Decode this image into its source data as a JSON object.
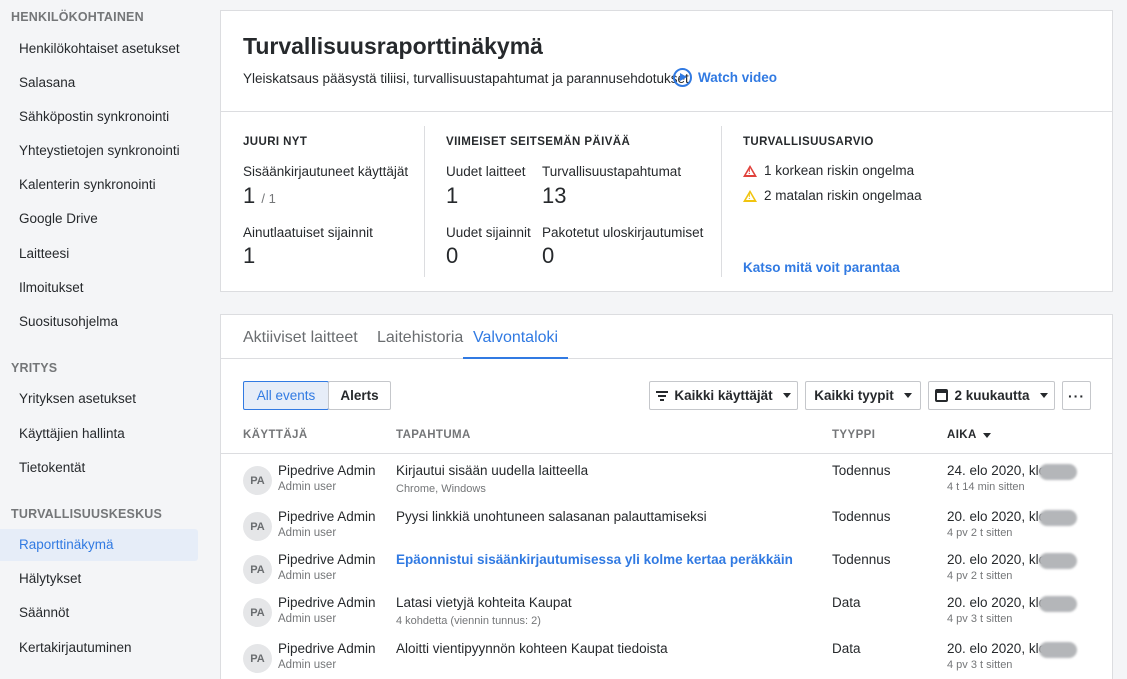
{
  "sidebar": {
    "sections": [
      {
        "title": "HENKILÖKOHTAINEN",
        "items": [
          "Henkilökohtaiset asetukset",
          "Salasana",
          "Sähköpostin synkronointi",
          "Yhteystietojen synkronointi",
          "Kalenterin synkronointi",
          "Google Drive",
          "Laitteesi",
          "Ilmoitukset",
          "Suositusohjelma"
        ]
      },
      {
        "title": "YRITYS",
        "items": [
          "Yrityksen asetukset",
          "Käyttäjien hallinta",
          "Tietokentät"
        ]
      },
      {
        "title": "TURVALLISUUSKESKUS",
        "items": [
          "Raporttinäkymä",
          "Hälytykset",
          "Säännöt",
          "Kertakirjautuminen"
        ]
      }
    ],
    "active_item": "Raporttinäkymä"
  },
  "header": {
    "title": "Turvallisuusraporttinäkymä",
    "subtitle": "Yleiskatsaus pääsystä tiliisi, turvallisuustapahtumat ja parannusehdotukset",
    "watch_video": "Watch video"
  },
  "stats": {
    "now": {
      "heading": "JUURI NYT",
      "logged_in_label": "Sisäänkirjautuneet käyttäjät",
      "logged_in_value": "1",
      "logged_in_total": "/ 1",
      "locations_label": "Ainutlaatuiset sijainnit",
      "locations_value": "1"
    },
    "week": {
      "heading": "VIIMEISET SEITSEMÄN PÄIVÄÄ",
      "new_devices_label": "Uudet laitteet",
      "new_devices_value": "1",
      "events_label": "Turvallisuustapahtumat",
      "events_value": "13",
      "new_locations_label": "Uudet sijainnit",
      "new_locations_value": "0",
      "forced_logouts_label": "Pakotetut uloskirjautumiset",
      "forced_logouts_value": "0"
    },
    "rating": {
      "heading": "TURVALLISUUSARVIO",
      "high_risk": "1 korkean riskin ongelma",
      "low_risk": "2 matalan riskin ongelmaa",
      "improve_link": "Katso mitä voit parantaa",
      "high_color": "#e0423c",
      "low_color": "#f1c40f"
    }
  },
  "tabs": [
    "Aktiiviset laitteet",
    "Laitehistoria",
    "Valvontaloki"
  ],
  "active_tab": "Valvontaloki",
  "filters": {
    "all_events": "All events",
    "alerts": "Alerts",
    "users": "Kaikki käyttäjät",
    "types": "Kaikki tyypit",
    "period": "2 kuukautta",
    "more": "···"
  },
  "table": {
    "columns": [
      "KÄYTTÄJÄ",
      "TAPAHTUMA",
      "TYYPPI",
      "AIKA"
    ],
    "rows": [
      {
        "initials": "PA",
        "user": "Pipedrive Admin",
        "role": "Admin user",
        "event": "Kirjautui sisään uudella laitteella",
        "detail": "Chrome, Windows",
        "type": "Todennus",
        "time": "24. elo 2020, klo",
        "ago": "4 t 14 min sitten",
        "link": false
      },
      {
        "initials": "PA",
        "user": "Pipedrive Admin",
        "role": "Admin user",
        "event": "Pyysi linkkiä unohtuneen salasanan palauttamiseksi",
        "detail": "",
        "type": "Todennus",
        "time": "20. elo 2020, klo",
        "ago": "4 pv 2 t sitten",
        "link": false
      },
      {
        "initials": "PA",
        "user": "Pipedrive Admin",
        "role": "Admin user",
        "event": "Epäonnistui sisäänkirjautumisessa yli kolme kertaa peräkkäin",
        "detail": "",
        "type": "Todennus",
        "time": "20. elo 2020, klo",
        "ago": "4 pv 2 t sitten",
        "link": true
      },
      {
        "initials": "PA",
        "user": "Pipedrive Admin",
        "role": "Admin user",
        "event": "Latasi vietyjä kohteita Kaupat",
        "detail": "4 kohdetta (viennin tunnus: 2)",
        "type": "Data",
        "time": "20. elo 2020, klo",
        "ago": "4 pv 3 t sitten",
        "link": false
      },
      {
        "initials": "PA",
        "user": "Pipedrive Admin",
        "role": "Admin user",
        "event": "Aloitti vientipyynnön kohteen Kaupat tiedoista",
        "detail": "",
        "type": "Data",
        "time": "20. elo 2020, klo",
        "ago": "4 pv 3 t sitten",
        "link": false
      }
    ]
  }
}
